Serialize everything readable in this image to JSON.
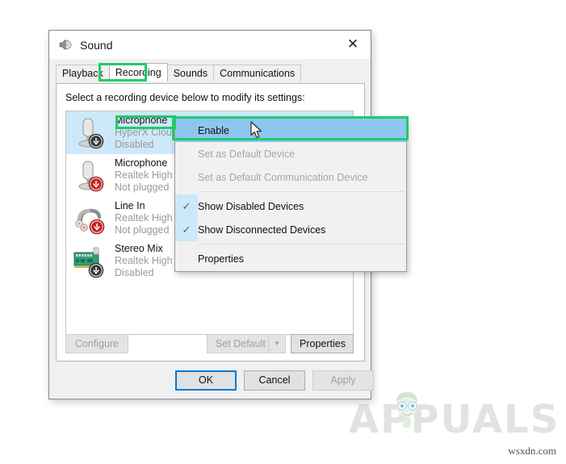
{
  "dialog": {
    "title": "Sound",
    "title_icon": "speaker-icon",
    "close_label": "✕",
    "panel_label": "Select a recording device below to modify its settings:",
    "tabs": [
      {
        "label": "Playback",
        "active": false
      },
      {
        "label": "Recording",
        "active": true
      },
      {
        "label": "Sounds",
        "active": false
      },
      {
        "label": "Communications",
        "active": false
      }
    ],
    "devices": [
      {
        "name": "Microphone",
        "driver": "HyperX Cloud",
        "state": "Disabled",
        "icon": "microphone-icon",
        "badge": "down-arrow-black-badge",
        "selected": true
      },
      {
        "name": "Microphone",
        "driver": "Realtek High",
        "state": "Not plugged",
        "icon": "microphone-icon",
        "badge": "down-arrow-red-badge",
        "selected": false
      },
      {
        "name": "Line In",
        "driver": "Realtek High",
        "state": "Not plugged",
        "icon": "line-in-rca-icon",
        "badge": "down-arrow-red-badge",
        "selected": false
      },
      {
        "name": "Stereo Mix",
        "driver": "Realtek High Definition Audio",
        "state": "Disabled",
        "icon": "sound-card-icon",
        "badge": "down-arrow-black-badge",
        "selected": false
      }
    ],
    "panel_buttons": {
      "configure": "Configure",
      "set_default": "Set Default",
      "set_default_arrow": "▼",
      "properties": "Properties"
    },
    "footer_buttons": {
      "ok": "OK",
      "cancel": "Cancel",
      "apply": "Apply"
    }
  },
  "context_menu": {
    "items": [
      {
        "label": "Enable",
        "state": "highlighted",
        "checked": false
      },
      {
        "label": "Set as Default Device",
        "state": "disabled",
        "checked": false
      },
      {
        "label": "Set as Default Communication Device",
        "state": "disabled",
        "checked": false
      },
      {
        "label": "Show Disabled Devices",
        "state": "normal",
        "checked": true
      },
      {
        "label": "Show Disconnected Devices",
        "state": "normal",
        "checked": true
      },
      {
        "label": "Properties",
        "state": "normal",
        "checked": false
      }
    ],
    "check_glyph": "✓"
  },
  "annotations": {
    "color": "#22c96b",
    "boxes": [
      "recording-tab",
      "microphone-device-name",
      "enable-menu-item"
    ]
  },
  "watermark": {
    "text": "APPUALS",
    "site": "wsxdn.com"
  }
}
